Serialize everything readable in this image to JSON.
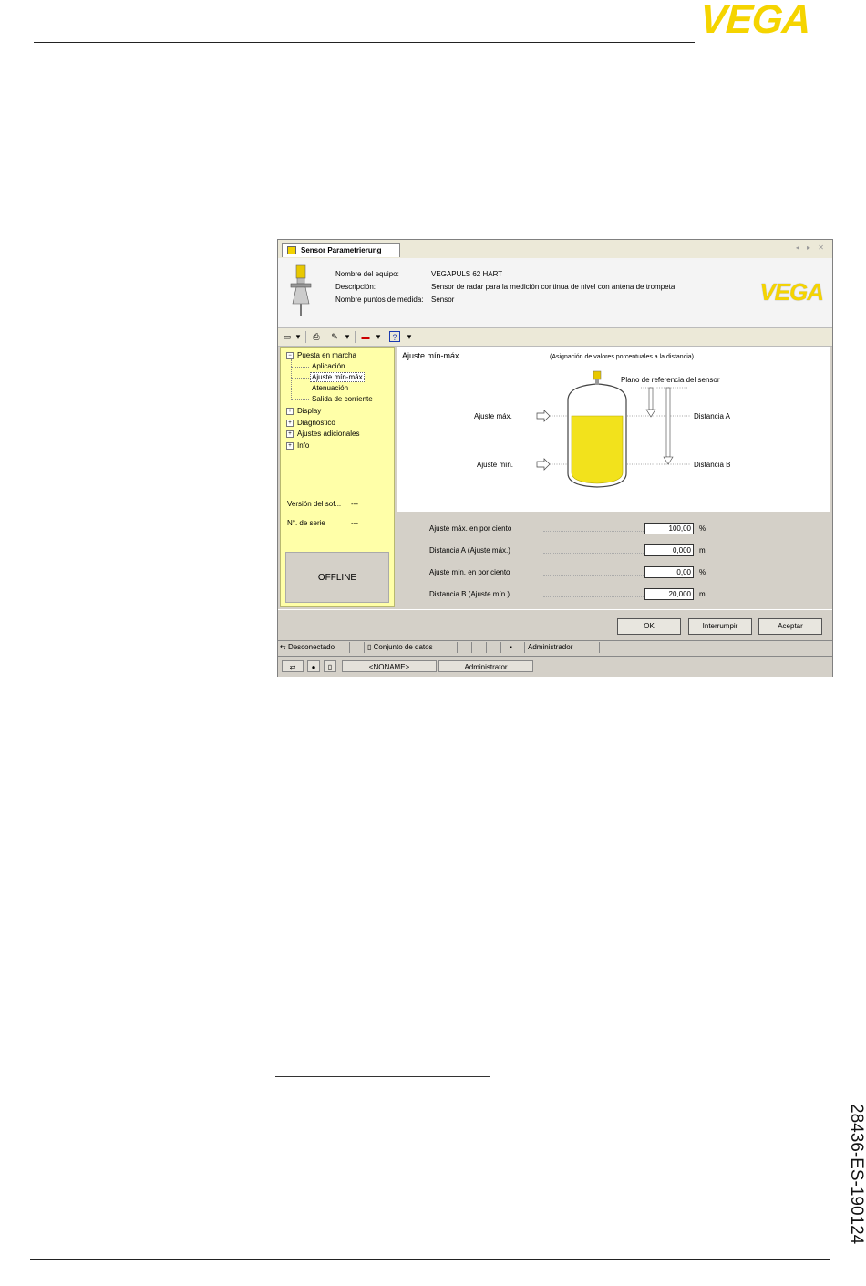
{
  "page": {
    "logo": "VEGA",
    "doc_number": "28436-ES-190124"
  },
  "window": {
    "tab_title": "Sensor Parametrierung",
    "tab_controls": "◂ ▸ ✕",
    "header": {
      "device_name_label": "Nombre del equipo:",
      "device_name_value": "VEGAPULS 62 HART",
      "description_label": "Descripción:",
      "description_value": "Sensor de radar para la medición continua de nivel con antena de trompeta",
      "measuring_point_label": "Nombre puntos de medida:",
      "measuring_point_value": "Sensor",
      "logo": "VEGA"
    },
    "tree": {
      "root": "Puesta en marcha",
      "children": [
        "Aplicación",
        "Ajuste mín-máx",
        "Atenuación",
        "Salida de corriente"
      ],
      "groups": [
        "Display",
        "Diagnóstico",
        "Ajustes adicionales",
        "Info"
      ],
      "software_version_label": "Versión del sof...",
      "software_version_value": "---",
      "serial_label": "N°. de serie",
      "serial_value": "---",
      "offline": "OFFLINE"
    },
    "diagram": {
      "title": "Ajuste mín-máx",
      "subtitle": "(Asignación de valores porcentuales a la distancia)",
      "ref_plane": "Plano de referencia del sensor",
      "max_label": "Ajuste máx.",
      "min_label": "Ajuste mín.",
      "dist_a": "Distancia A",
      "dist_b": "Distancia B"
    },
    "form": {
      "rows": [
        {
          "label": "Ajuste máx. en por ciento",
          "value": "100,00",
          "unit": "%"
        },
        {
          "label": "Distancia A (Ajuste máx.)",
          "value": "0,000",
          "unit": "m"
        },
        {
          "label": "Ajuste mín. en por ciento",
          "value": "0,00",
          "unit": "%"
        },
        {
          "label": "Distancia B (Ajuste mín.)",
          "value": "20,000",
          "unit": "m"
        }
      ]
    },
    "buttons": {
      "ok": "OK",
      "cancel": "Interrumpir",
      "apply": "Aceptar"
    },
    "status1": {
      "connection": "Desconectado",
      "dataset": "Conjunto de datos",
      "role": "Administrador"
    },
    "status2": {
      "project": "<NONAME>",
      "user": "Administrator"
    }
  }
}
